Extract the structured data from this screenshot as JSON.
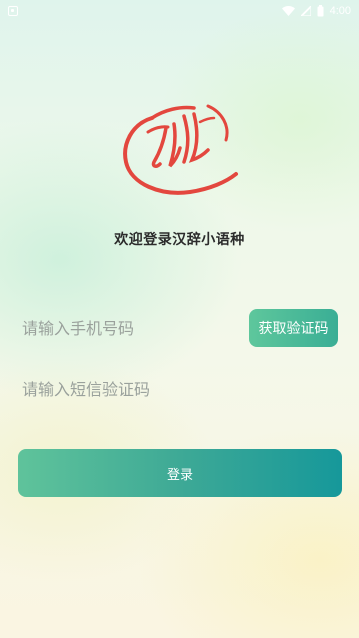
{
  "status_bar": {
    "time": "4:00",
    "icons": [
      "notification-icon",
      "wifi-icon",
      "signal-icon",
      "battery-icon"
    ]
  },
  "app": {
    "title": "欢迎登录汉辞小语种",
    "logo_color": "#e3473e"
  },
  "form": {
    "phone_placeholder": "请输入手机号码",
    "get_code_label": "获取验证码",
    "sms_placeholder": "请输入短信验证码",
    "login_label": "登录"
  },
  "colors": {
    "accent_start": "#5fc39b",
    "accent_end": "#16989a"
  }
}
